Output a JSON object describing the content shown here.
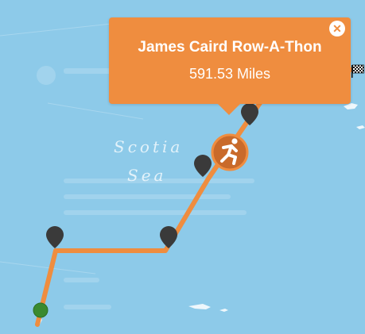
{
  "map": {
    "sea_label_line1": "Scotia",
    "sea_label_line2": "Sea",
    "route_color": "#ef8d3f",
    "water_color": "#8dcae9",
    "start_marker_color": "#3a8a2f",
    "waypoint_color": "#3a3a3a"
  },
  "popup": {
    "title": "James Caird Row-A-Thon",
    "distance": "591.53 Miles",
    "close_icon": "close-icon",
    "background_color": "#ef8d3f"
  },
  "icons": {
    "runner": "runner-icon",
    "finish": "checkered-flag-icon",
    "waypoint": "map-pin-icon",
    "start": "start-dot-icon"
  }
}
